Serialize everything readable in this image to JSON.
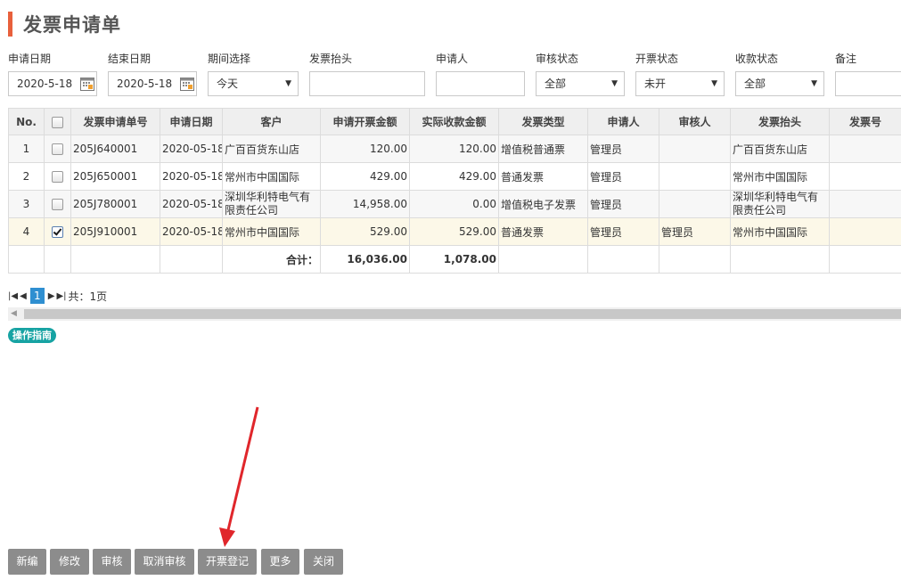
{
  "page": {
    "title": "发票申请单"
  },
  "filters": {
    "start_date": {
      "label": "申请日期",
      "value": "2020-5-18"
    },
    "end_date": {
      "label": "结束日期",
      "value": "2020-5-18"
    },
    "period": {
      "label": "期间选择",
      "value": "今天"
    },
    "invoice_header": {
      "label": "发票抬头",
      "value": ""
    },
    "applicant": {
      "label": "申请人",
      "value": ""
    },
    "audit_status": {
      "label": "审核状态",
      "value": "全部"
    },
    "invoice_status": {
      "label": "开票状态",
      "value": "未开"
    },
    "payment_status": {
      "label": "收款状态",
      "value": "全部"
    },
    "remark": {
      "label": "备注",
      "value": ""
    }
  },
  "table": {
    "headers": [
      "No.",
      "",
      "发票申请单号",
      "申请日期",
      "客户",
      "申请开票金额",
      "实际收款金额",
      "发票类型",
      "申请人",
      "审核人",
      "发票抬头",
      "发票号"
    ],
    "rows": [
      {
        "no": "1",
        "checked": false,
        "code": "205J640001",
        "date": "2020-05-18",
        "customer": "广百百货东山店",
        "apply_amount": "120.00",
        "actual_amount": "120.00",
        "type": "增值税普通票",
        "applicant": "管理员",
        "auditor": "",
        "header": "广百百货东山店",
        "invoice_no": ""
      },
      {
        "no": "2",
        "checked": false,
        "code": "205J650001",
        "date": "2020-05-18",
        "customer": "常州市中国国际",
        "apply_amount": "429.00",
        "actual_amount": "429.00",
        "type": "普通发票",
        "applicant": "管理员",
        "auditor": "",
        "header": "常州市中国国际",
        "invoice_no": ""
      },
      {
        "no": "3",
        "checked": false,
        "code": "205J780001",
        "date": "2020-05-18",
        "customer": "深圳华利特电气有限责任公司",
        "apply_amount": "14,958.00",
        "actual_amount": "0.00",
        "type": "增值税电子发票",
        "applicant": "管理员",
        "auditor": "",
        "header": "深圳华利特电气有限责任公司",
        "invoice_no": ""
      },
      {
        "no": "4",
        "checked": true,
        "code": "205J910001",
        "date": "2020-05-18",
        "customer": "常州市中国国际",
        "apply_amount": "529.00",
        "actual_amount": "529.00",
        "type": "普通发票",
        "applicant": "管理员",
        "auditor": "管理员",
        "header": "常州市中国国际",
        "invoice_no": ""
      }
    ],
    "total": {
      "label": "合计：",
      "apply_amount": "16,036.00",
      "actual_amount": "1,078.00"
    }
  },
  "pager": {
    "current": "1",
    "total_text": "共：1页"
  },
  "guide": {
    "label": "操作指南"
  },
  "buttons": {
    "new": "新编",
    "edit": "修改",
    "audit": "审核",
    "unaudit": "取消审核",
    "register": "开票登记",
    "more": "更多",
    "close": "关闭"
  },
  "colors": {
    "accent": "#e8603c",
    "button": "#8c8c8c",
    "page_active": "#2f8fd1",
    "guide": "#17a3a3",
    "annotation": "#e0262b"
  }
}
